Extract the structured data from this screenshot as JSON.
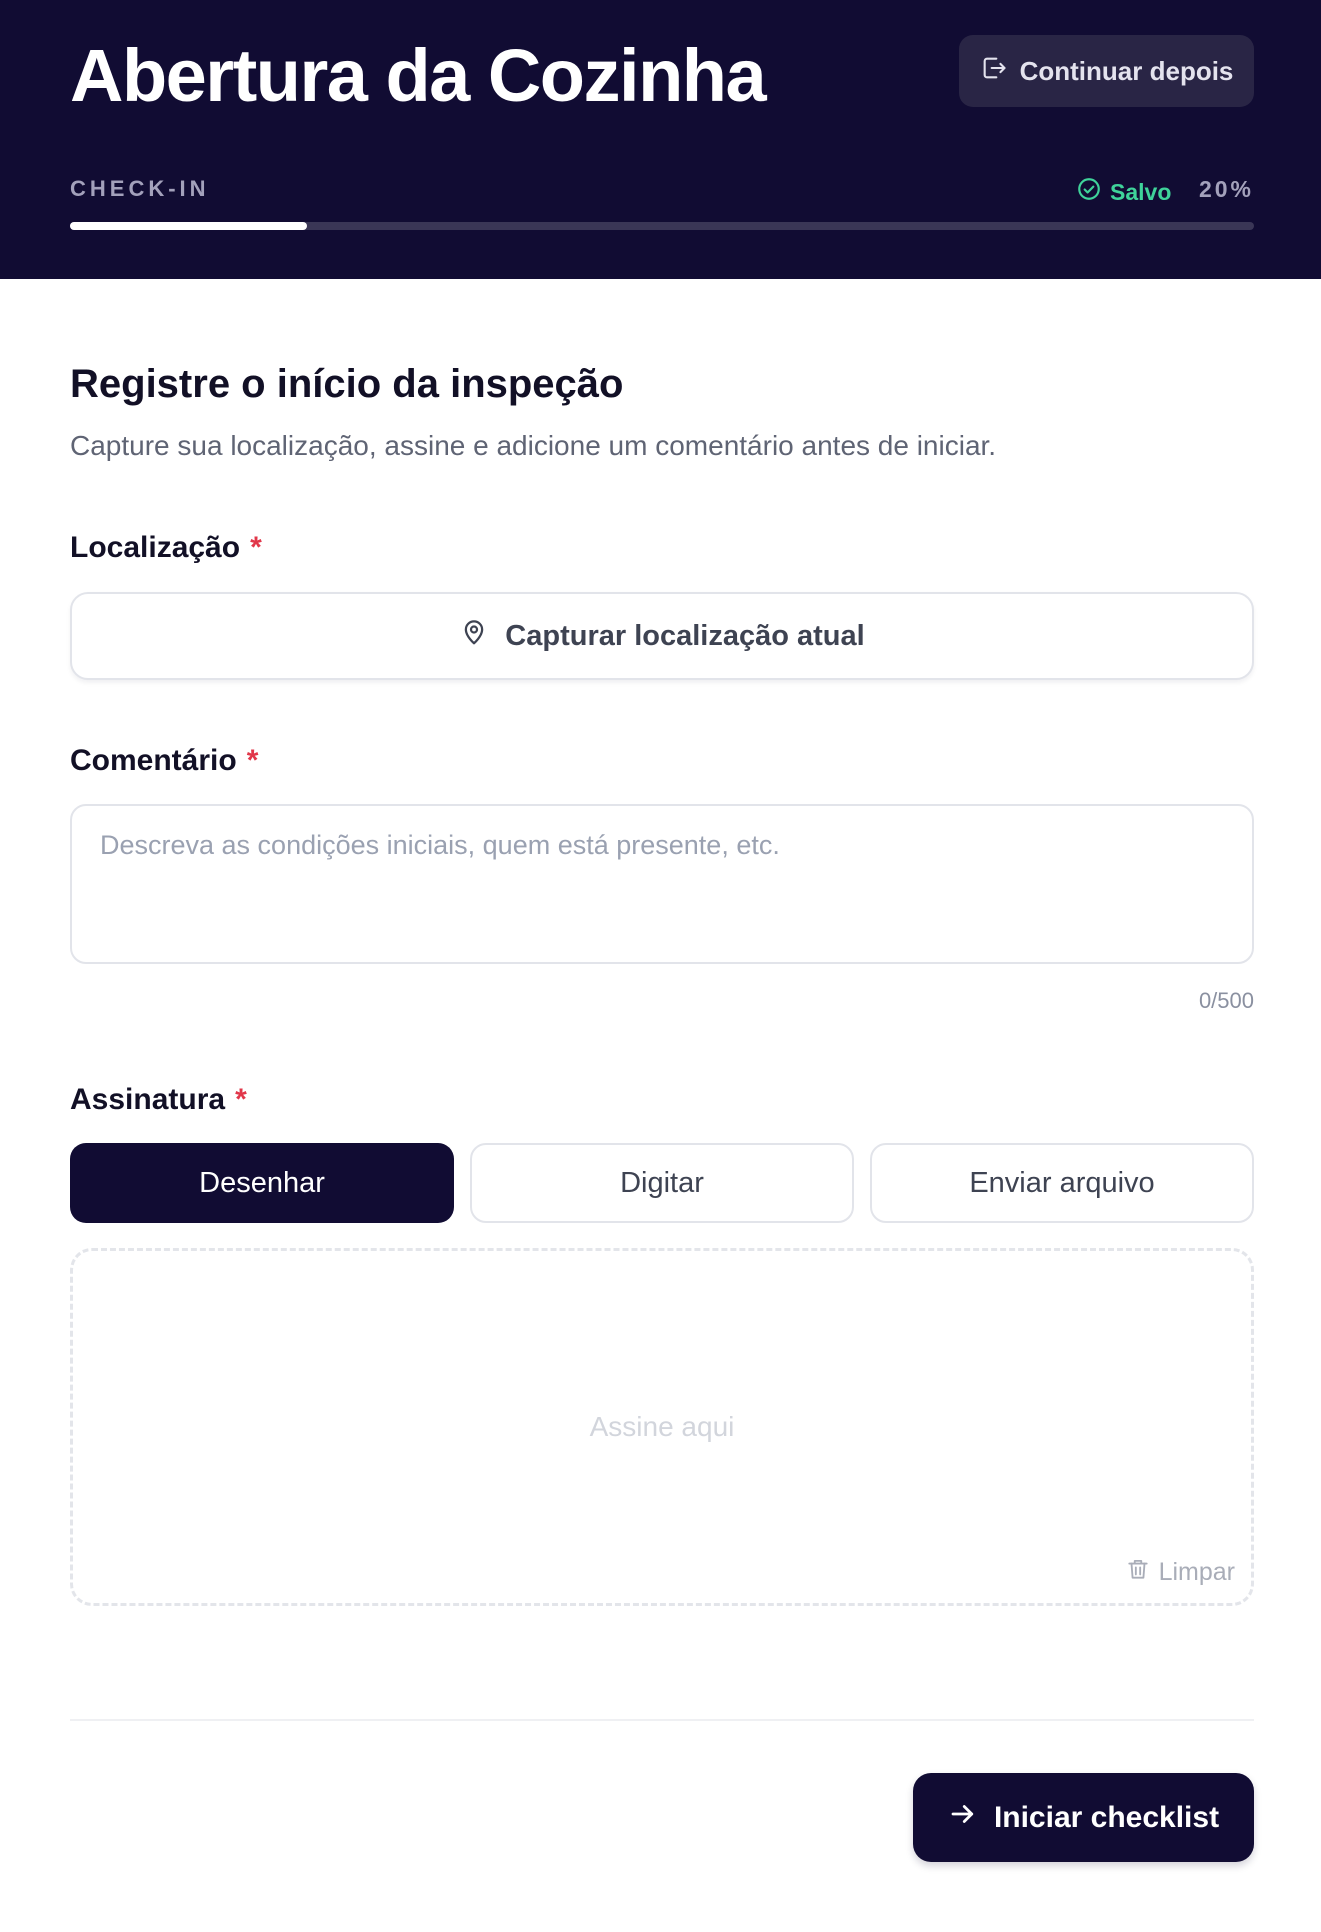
{
  "header": {
    "title": "Abertura da Cozinha",
    "continue_label": "Continuar depois",
    "step_label": "CHECK-IN",
    "saved_label": "Salvo",
    "progress_text": "20%",
    "progress_fraction": 0.2
  },
  "intro": {
    "heading": "Registre o início da inspeção",
    "subtitle": "Capture sua localização, assine e adicione um comentário antes de iniciar."
  },
  "location": {
    "label": "Localização",
    "required_mark": "*",
    "button_label": "Capturar localização atual",
    "icon": "map-pin-icon"
  },
  "comment": {
    "label": "Comentário",
    "required_mark": "*",
    "placeholder": "Descreva as condições iniciais, quem está presente, etc.",
    "value": "",
    "counter": "0/500"
  },
  "signature": {
    "label": "Assinatura",
    "required_mark": "*",
    "modes": [
      "Desenhar",
      "Digitar",
      "Enviar arquivo"
    ],
    "active_mode": "Desenhar",
    "pad_hint": "Assine aqui",
    "clear_label": "Limpar"
  },
  "footer": {
    "start_label": "Iniciar checklist"
  },
  "colors": {
    "header_bg": "#110c33",
    "accent": "#110c33",
    "saved": "#3fd39a",
    "required": "#e1374a"
  }
}
